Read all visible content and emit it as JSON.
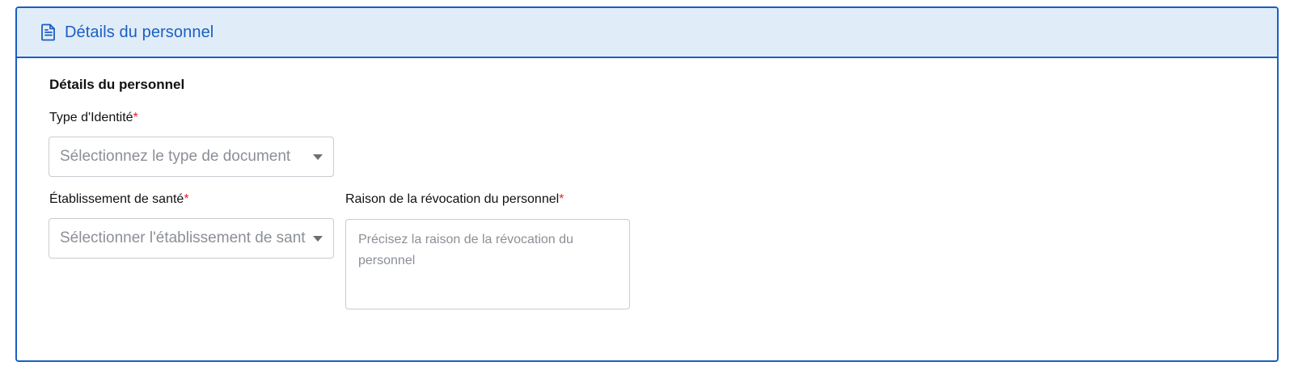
{
  "card": {
    "header_title": "Détails du personnel",
    "header_icon": "document-icon",
    "accent_color": "#1a5fc1",
    "header_bg": "#e1ecf9"
  },
  "form": {
    "section_title": "Détails du personnel",
    "identity_type": {
      "label": "Type d'Identité",
      "required_mark": "*",
      "placeholder": "Sélectionnez le type de document"
    },
    "health_facility": {
      "label": "Établissement de santé",
      "required_mark": "*",
      "placeholder": "Sélectionner l'établissement de santé"
    },
    "revocation_reason": {
      "label": "Raison de la révocation du personnel",
      "required_mark": "*",
      "placeholder": "Précisez la raison de la révocation du personnel"
    }
  }
}
